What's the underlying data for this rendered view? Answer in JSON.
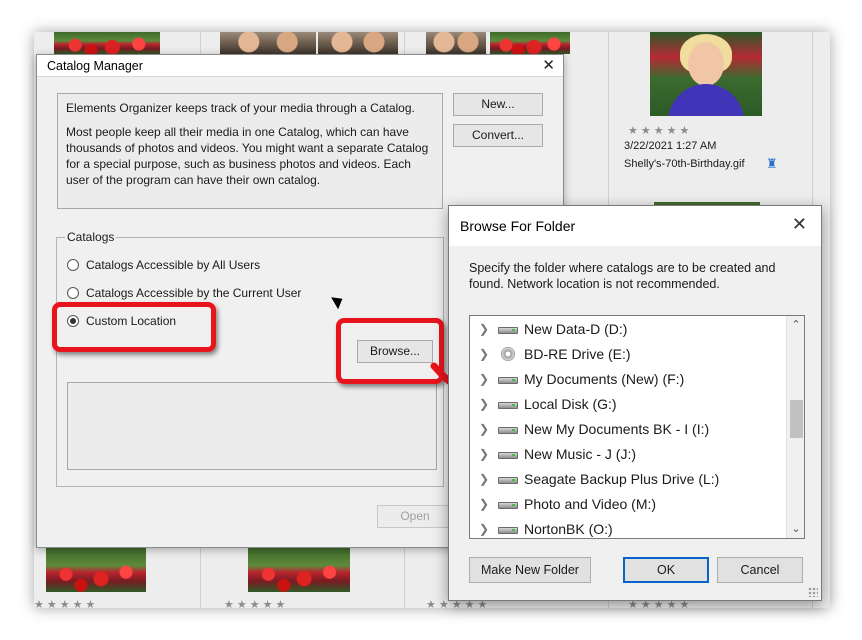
{
  "background": {
    "photo_date": "3/22/2021 1:27 AM",
    "photo_filename": "Shelly's-70th-Birthday.gif",
    "rating_stars": "★★★★★"
  },
  "catalog_manager": {
    "title": "Catalog Manager",
    "close_glyph": "✕",
    "description_line1": "Elements Organizer keeps track of your media through a Catalog.",
    "description_line2": "Most people keep all their media in one Catalog, which can have thousands of photos and videos. You might want a separate Catalog for a special purpose, such as business photos and videos. Each user of the program can have their own catalog.",
    "new_button": "New...",
    "convert_button": "Convert...",
    "catalogs_legend": "Catalogs",
    "radio_all_users": "Catalogs Accessible by All Users",
    "radio_current_user": "Catalogs Accessible by the Current User",
    "radio_custom": "Custom Location",
    "selected_radio": "Custom Location",
    "browse_button": "Browse...",
    "open_button": "Open"
  },
  "browse_for_folder": {
    "title": "Browse For Folder",
    "close_glyph": "✕",
    "instructions": "Specify the folder where catalogs are to be created and found. Network location is not recommended.",
    "drives": [
      {
        "label": "New Data-D (D:)",
        "icon": "hard-drive-icon"
      },
      {
        "label": "BD-RE Drive (E:)",
        "icon": "optical-drive-icon"
      },
      {
        "label": "My Documents (New) (F:)",
        "icon": "hard-drive-icon"
      },
      {
        "label": "Local Disk (G:)",
        "icon": "hard-drive-icon"
      },
      {
        "label": "New My Documents BK - I (I:)",
        "icon": "hard-drive-icon"
      },
      {
        "label": "New Music - J (J:)",
        "icon": "hard-drive-icon"
      },
      {
        "label": "Seagate Backup Plus Drive (L:)",
        "icon": "hard-drive-icon"
      },
      {
        "label": "Photo and Video (M:)",
        "icon": "hard-drive-icon"
      },
      {
        "label": "NortonBK (O:)",
        "icon": "hard-drive-icon"
      }
    ],
    "make_new_folder_button": "Make New Folder",
    "ok_button": "OK",
    "cancel_button": "Cancel"
  },
  "annotations": {
    "callout_color": "#e8141b",
    "arrow_color": "#e8141b"
  }
}
